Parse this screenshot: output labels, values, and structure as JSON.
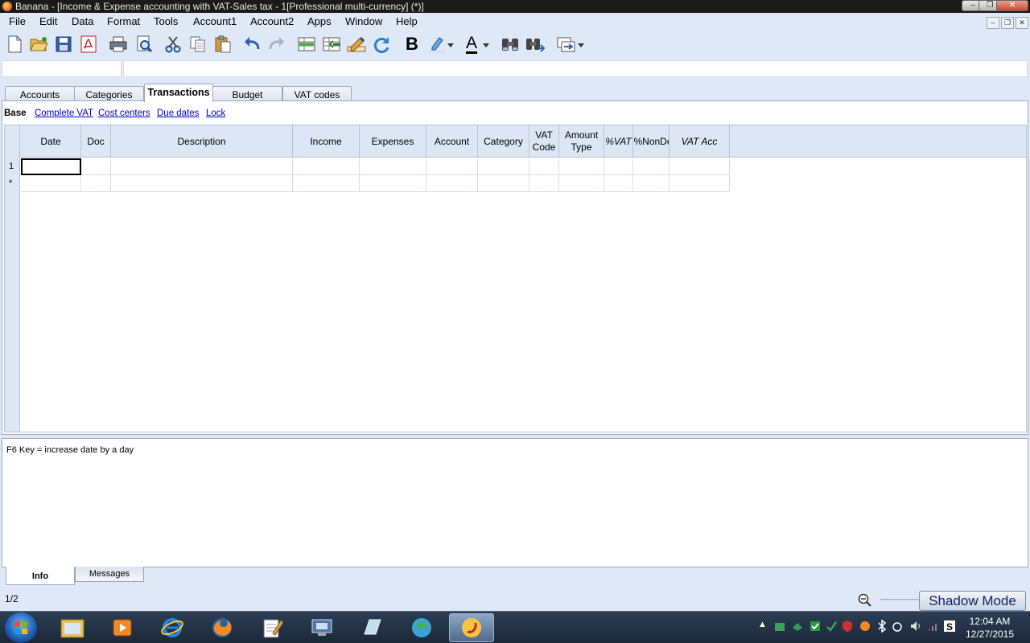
{
  "window": {
    "title": "Banana - [Income & Expense accounting with VAT-Sales tax - 1[Professional multi-currency] (*)]",
    "controls": [
      "minimize",
      "restore",
      "close"
    ]
  },
  "menu": [
    "File",
    "Edit",
    "Data",
    "Format",
    "Tools",
    "Account1",
    "Account2",
    "Apps",
    "Window",
    "Help"
  ],
  "toolbar": {
    "bold_label": "B",
    "font_color_label": "A"
  },
  "tabs": [
    {
      "label": "Accounts",
      "active": false
    },
    {
      "label": "Categories",
      "active": false
    },
    {
      "label": "Transactions",
      "active": true
    },
    {
      "label": "Budget",
      "active": false
    },
    {
      "label": "VAT codes",
      "active": false
    }
  ],
  "views": {
    "current": "Base",
    "links": [
      "Complete VAT",
      "Cost centers",
      "Due dates",
      "Lock"
    ]
  },
  "table": {
    "columns": [
      {
        "label": "Date",
        "italic": false
      },
      {
        "label": "Doc",
        "italic": false
      },
      {
        "label": "Description",
        "italic": false
      },
      {
        "label": "Income",
        "italic": false
      },
      {
        "label": "Expenses",
        "italic": false
      },
      {
        "label": "Account",
        "italic": false
      },
      {
        "label": "Category",
        "italic": false
      },
      {
        "label": "VAT Code",
        "italic": false
      },
      {
        "label": "Amount Type",
        "italic": false
      },
      {
        "label": "%VAT",
        "italic": true
      },
      {
        "label": "%NonDed",
        "italic": false
      },
      {
        "label": "VAT Acc",
        "italic": true
      }
    ],
    "rows": [
      {
        "num": "1",
        "cells": [
          "",
          "",
          "",
          "",
          "",
          "",
          "",
          "",
          "",
          "",
          "",
          ""
        ]
      },
      {
        "num": "*",
        "cells": [
          "",
          "",
          "",
          "",
          "",
          "",
          "",
          "",
          "",
          "",
          "",
          ""
        ]
      }
    ]
  },
  "info": {
    "text": "F6 Key = increase date by a day",
    "tabs": [
      "Info",
      "Messages"
    ],
    "active_tab": "Info"
  },
  "status": {
    "page": "1/2",
    "shadow_mode": "Shadow Mode"
  },
  "taskbar": {
    "time": "12:04 AM",
    "date": "12/27/2015"
  }
}
